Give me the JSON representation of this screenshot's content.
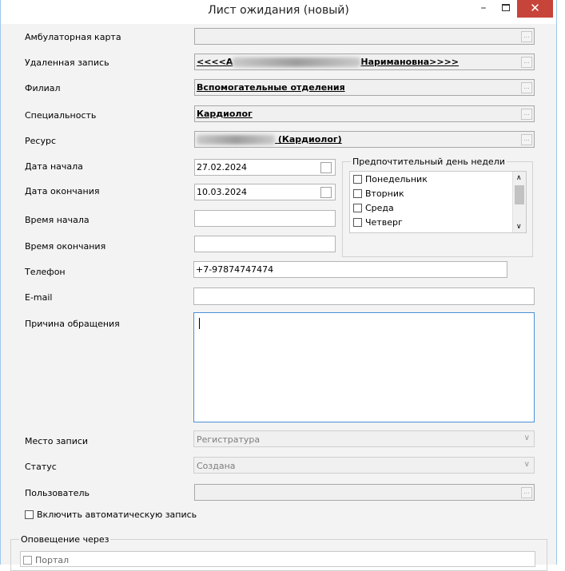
{
  "window": {
    "title": "Лист ожидания (новый)",
    "minimize": "–",
    "close": "✕"
  },
  "labels": {
    "card": "Амбулаторная карта",
    "remote": "Удаленная запись",
    "branch": "Филиал",
    "specialty": "Специальность",
    "resource": "Ресурс",
    "date_start": "Дата начала",
    "date_end": "Дата окончания",
    "time_start": "Время начала",
    "time_end": "Время окончания",
    "phone": "Телефон",
    "email": "E-mail",
    "reason": "Причина обращения",
    "place": "Место записи",
    "status": "Статус",
    "user": "Пользователь"
  },
  "values": {
    "remote_prefix": "<<<<А",
    "remote_suffix": "Наримановна>>>>",
    "branch": "Вспомогательные отделения",
    "specialty": "Кардиолог",
    "resource_suffix": "(Кардиолог)",
    "date_start": "27.02.2024",
    "date_end": "10.03.2024",
    "phone": "+7-97874747474",
    "place": "Регистратура",
    "status": "Создана"
  },
  "weekday_group": {
    "title": "Предпочтительный день недели",
    "days": [
      "Понедельник",
      "Вторник",
      "Среда",
      "Четверг"
    ]
  },
  "auto_record": "Включить автоматическую запись",
  "notify": {
    "title": "Оповещение через",
    "portal": "Портал"
  },
  "icons": {
    "ellipsis": "...",
    "dropdown": "∨",
    "scroll_up": "∧",
    "scroll_down": "∨"
  }
}
